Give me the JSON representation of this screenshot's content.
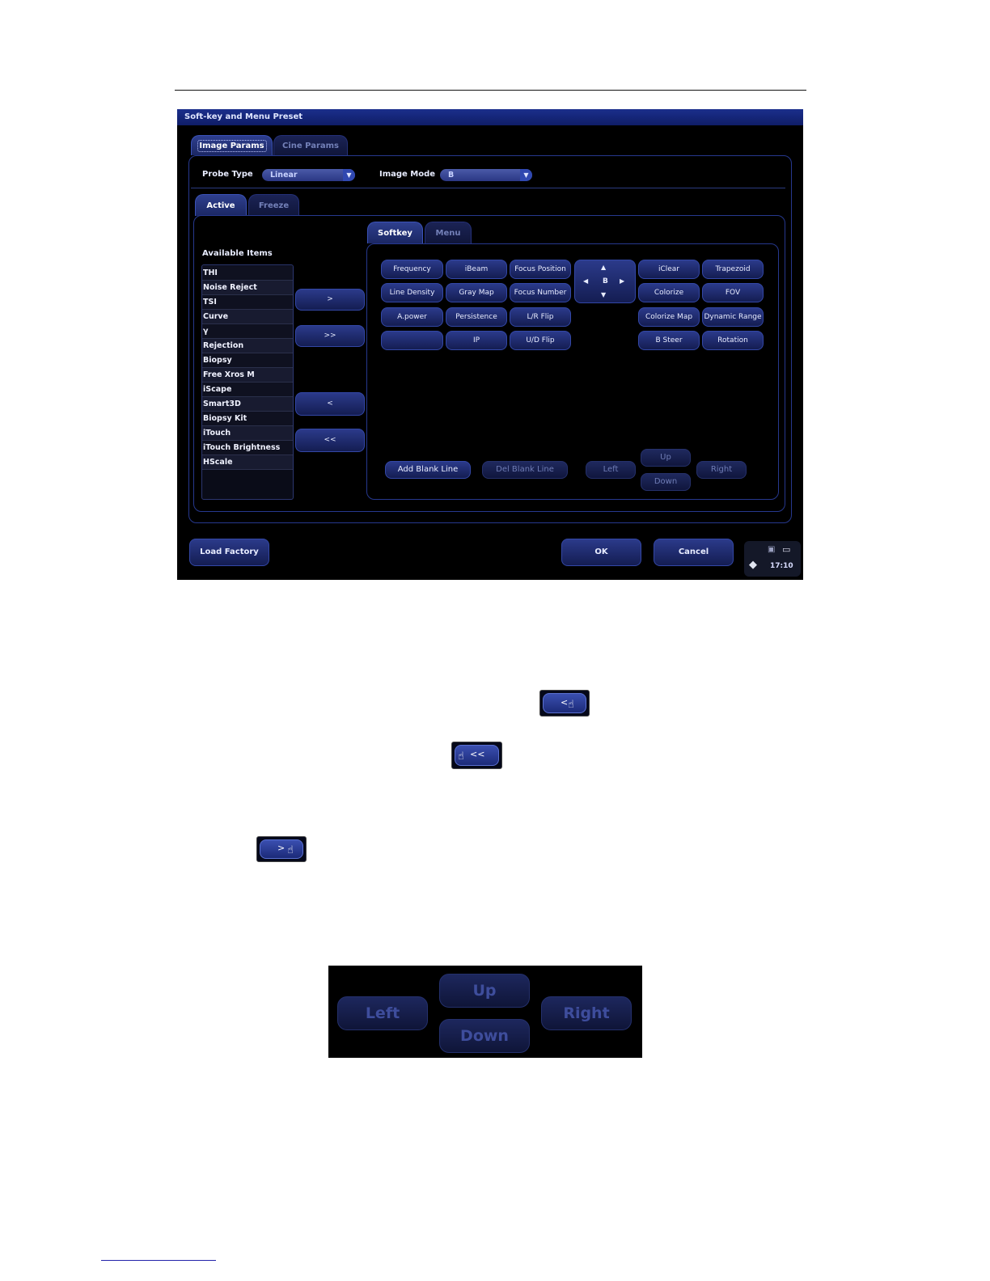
{
  "window": {
    "title": "Soft-key and Menu Preset"
  },
  "tabs_main": [
    {
      "label": "Image Params"
    },
    {
      "label": "Cine Params"
    }
  ],
  "probe": {
    "label": "Probe Type",
    "value": "Linear"
  },
  "image_mode": {
    "label": "Image Mode",
    "value": "B"
  },
  "tabs_state": [
    {
      "label": "Active"
    },
    {
      "label": "Freeze"
    }
  ],
  "available": {
    "title": "Available Items",
    "items": [
      "THI",
      "Noise Reject",
      "TSI",
      "Curve",
      "γ",
      "Rejection",
      "Biopsy",
      "Free Xros M",
      "iScape",
      "Smart3D",
      "Biopsy Kit",
      "iTouch",
      "iTouch Brightness",
      "HScale"
    ]
  },
  "transfer": {
    "add": ">",
    "add_all": ">>",
    "remove": "<",
    "remove_all": "<<"
  },
  "tabs_panel": [
    {
      "label": "Softkey"
    },
    {
      "label": "Menu"
    }
  ],
  "softkeys": {
    "col1": [
      "Frequency",
      "Line Density",
      "A.power",
      ""
    ],
    "col2": [
      "iBeam",
      "Gray Map",
      "Persistence",
      "IP"
    ],
    "col3": [
      "Focus Position",
      "Focus Number",
      "L/R Flip",
      "U/D Flip"
    ],
    "col5": [
      "iClear",
      "Colorize",
      "Colorize Map",
      "B Steer"
    ],
    "col6": [
      "Trapezoid",
      "FOV",
      "Dynamic Range",
      "Rotation"
    ],
    "dpad": {
      "up": "▲",
      "down": "▼",
      "left": "◀",
      "right": "▶",
      "center": "B"
    }
  },
  "layout_buttons": {
    "add_blank": "Add Blank Line",
    "del_blank": "Del Blank Line",
    "left": "Left",
    "up": "Up",
    "down": "Down",
    "right": "Right"
  },
  "footer": {
    "load_factory": "Load Factory",
    "ok": "OK",
    "cancel": "Cancel"
  },
  "status": {
    "time": "17:10"
  },
  "snippets": {
    "remove": {
      "label": "<"
    },
    "remove_all": {
      "label": "<<"
    },
    "add": {
      "label": ">"
    }
  },
  "direction_image": {
    "left": "Left",
    "up": "Up",
    "down": "Down",
    "right": "Right"
  }
}
